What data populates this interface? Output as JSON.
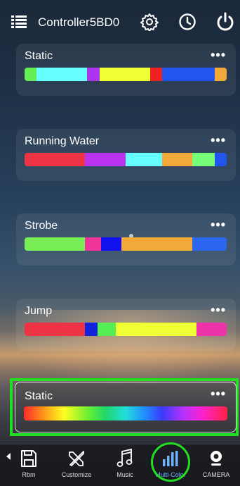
{
  "header": {
    "title": "Controller5BD0",
    "menu_icon": "list-icon",
    "settings_icon": "gear-icon",
    "timer_icon": "clock-icon",
    "power_icon": "power-icon"
  },
  "modes": [
    {
      "label": "Static",
      "more": "•••",
      "segments": [
        {
          "color": "#66ee55",
          "w": 6
        },
        {
          "color": "#66ffff",
          "w": 25
        },
        {
          "color": "#aa33ee",
          "w": 6
        },
        {
          "color": "#eeff33",
          "w": 25
        },
        {
          "color": "#ee2222",
          "w": 6
        },
        {
          "color": "#2255ee",
          "w": 26
        },
        {
          "color": "#f3a83a",
          "w": 6
        }
      ]
    },
    {
      "label": "Running Water",
      "more": "•••",
      "segments": [
        {
          "color": "#ee3344",
          "w": 30
        },
        {
          "color": "#bb33ee",
          "w": 20
        },
        {
          "color": "#66ffff",
          "w": 18
        },
        {
          "color": "#f3a83a",
          "w": 15
        },
        {
          "color": "#77ff77",
          "w": 11
        },
        {
          "color": "#2255ee",
          "w": 6
        }
      ]
    },
    {
      "label": "Strobe",
      "more": "•••",
      "segments": [
        {
          "color": "#77ee55",
          "w": 30
        },
        {
          "color": "#ee3399",
          "w": 8
        },
        {
          "color": "#1111ee",
          "w": 10
        },
        {
          "color": "#f3a83a",
          "w": 35
        },
        {
          "color": "#2a66ee",
          "w": 17
        }
      ]
    },
    {
      "label": "Jump",
      "more": "•••",
      "segments": [
        {
          "color": "#ee3344",
          "w": 30
        },
        {
          "color": "#1122dd",
          "w": 6
        },
        {
          "color": "#55ee55",
          "w": 9
        },
        {
          "color": "#eeff33",
          "w": 40
        },
        {
          "color": "#ee33aa",
          "w": 15
        }
      ]
    },
    {
      "label": "Static",
      "more": "•••",
      "rainbow": true
    }
  ],
  "bottom_nav": [
    {
      "label": "Rbm",
      "icon": "save-icon"
    },
    {
      "label": "Customize",
      "icon": "tools-icon"
    },
    {
      "label": "Music",
      "icon": "music-note-icon"
    },
    {
      "label": "Multi-Color",
      "icon": "bars-icon",
      "active": true
    },
    {
      "label": "CAMERA",
      "icon": "camera-icon"
    }
  ],
  "colors": {
    "highlight": "#22dd22",
    "active_tab": "#6fb3ff"
  }
}
